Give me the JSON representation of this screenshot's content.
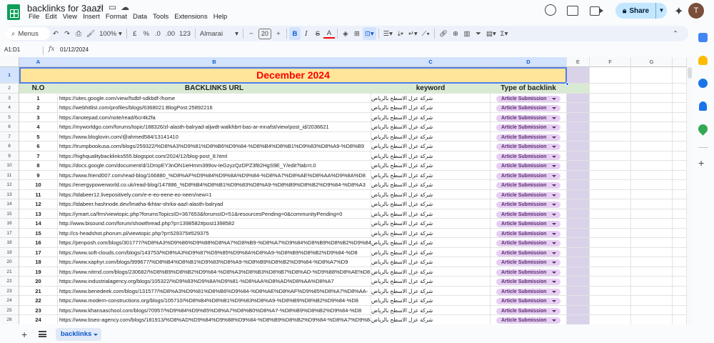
{
  "doc": {
    "title": "backlinks for 3aazl",
    "menu": [
      "File",
      "Edit",
      "View",
      "Insert",
      "Format",
      "Data",
      "Tools",
      "Extensions",
      "Help"
    ],
    "share_label": "Share",
    "avatar_letter": "T"
  },
  "toolbar": {
    "menus_label": "Menus",
    "zoom": "100%",
    "currency": "£",
    "percent": "%",
    "dec_decrease": ".0",
    "dec_increase": ".00",
    "number_format": "123",
    "font_name": "Almarai",
    "font_size": "20",
    "bold": "B",
    "italic": "I",
    "strike": "S",
    "text_color": "A"
  },
  "formula_bar": {
    "name_box": "A1:D1",
    "fx": "fx",
    "value": "01/12/2024"
  },
  "grid": {
    "columns": [
      "A",
      "B",
      "C",
      "D",
      "E",
      "F",
      "G"
    ],
    "title": "December 2024",
    "headers": [
      "N.O",
      "BACKLINKS URL",
      "keyword",
      "Type of backlink"
    ],
    "rows": [
      {
        "n": "1",
        "url": "https://sites.google.com/view/fsdbf-sdkbdf-/home",
        "kw": "شركة عزل الاسطح بالرياض",
        "type": "Article Submission"
      },
      {
        "n": "2",
        "url": "https://webhitlist.com/profiles/blogs/6368021:BlogPost:25892216",
        "kw": "شركة عزل الاسطح بالرياض",
        "type": "Article Submission"
      },
      {
        "n": "3",
        "url": "https://anotepad.com/note/read/6cr4k2fa",
        "kw": "شركة عزل الاسطح بالرياض",
        "type": "Article Submission"
      },
      {
        "n": "4",
        "url": "https://myworldgo.com/forums/topic/188326/zl-alasth-balryad-aljwdt-walkhbrt-bas-ar-mnafst/view/post_id/2036621",
        "kw": "شركة عزل الاسطح بالرياض",
        "type": "Article Submission"
      },
      {
        "n": "5",
        "url": "https://www.bloglovin.com/@ahmed584/13141410",
        "kw": "شركة عزل الاسطح بالرياض",
        "type": "Article Submission"
      },
      {
        "n": "6",
        "url": "https://trumpbookusa.com/blogs/259322/%D8%A3%D9%81%D8%B6%D9%84-%D8%B4%D8%B1%D9%83%D8%A9-%D8%B9",
        "kw": "شركة عزل الاسطح بالرياض",
        "type": "Article Submission"
      },
      {
        "n": "7",
        "url": "https://highqualitybacklinks555.blogspot.com/2024/12/blog-post_8.html",
        "kw": "شركة عزل الاسطح بالرياض",
        "type": "Article Submission"
      },
      {
        "n": "8",
        "url": "https://docs.google.com/document/d/1DmpEY3nON1ieHmm399ov-leGzyzQzDPZ3f82HgS9E_Y/edit?tab=t.0",
        "kw": "شركة عزل الاسطح بالرياض",
        "type": "Article Submission"
      },
      {
        "n": "9",
        "url": "https://www.friend007.com/read-blog/166880_%D8%AF%D9%84%D9%8A%D9%84-%D8%A7%D8%AE%D8%AA%D9%8A%D8",
        "kw": "شركة عزل الاسطح بالرياض",
        "type": "Article Submission"
      },
      {
        "n": "10",
        "url": "https://energypowerworld.co.uk/read-blog/147886_%D8%B4%D8%B1%D9%83%D8%A9-%D8%B9%D8%B2%D9%84-%D8%A3",
        "kw": "شركة عزل الاسطح بالرياض",
        "type": "Article Submission"
      },
      {
        "n": "11",
        "url": "https://tdabeer12.livepositively.com/e-e-eo-eene-eo-neen/new=1",
        "kw": "شركة عزل الاسطح بالرياض",
        "type": "Article Submission"
      },
      {
        "n": "12",
        "url": "https://tdabeer.hashnode.dev/lmatha-tkhtar-shrka-aazl-alasth-balryad",
        "kw": "شركة عزل الاسطح بالرياض",
        "type": "Article Submission"
      },
      {
        "n": "13",
        "url": "https://ymart.ca/frm/viewtopic.php?forumsTopicsID=367653&forumsID=51&resourcesPending=0&communityPending=0",
        "kw": "شركة عزل الاسطح بالرياض",
        "type": "Article Submission"
      },
      {
        "n": "14",
        "url": "http://www.bisound.com/forum/showthread.php?p=1398582#post1398582",
        "kw": "شركة عزل الاسطح بالرياض",
        "type": "Article Submission"
      },
      {
        "n": "15",
        "url": "http://cs-headshot.phorum.pl/viewtopic.php?p=529375#529375",
        "kw": "شركة عزل الاسطح بالرياض",
        "type": "Article Submission"
      },
      {
        "n": "16",
        "url": "https://penposh.com/blogs/301777/%D8%A3%D9%86%D9%88%D8%A7%D8%B9-%D8%A7%D9%84%D8%B9%D8%B2%D9%84-",
        "kw": "شركة عزل الاسطح بالرياض",
        "type": "Article Submission"
      },
      {
        "n": "17",
        "url": "https://www.soft-clouds.com/blogs/143753/%D8%A3%D9%87%D9%85%D9%8A%D8%A9-%D8%B9%D8%B2%D9%84-%D8",
        "kw": "شركة عزل الاسطح بالرياض",
        "type": "Article Submission"
      },
      {
        "n": "18",
        "url": "https://www.xaphyr.com/blogs/999677/%D8%B4%D8%B1%D9%83%D8%A9-%D8%B9%D8%B2%D9%84-%D8%A7%D9",
        "kw": "شركة عزل الاسطح بالرياض",
        "type": "Article Submission"
      },
      {
        "n": "19",
        "url": "https://www.nitrnd.com/blogs/230682/%D8%B9%D8%B2%D9%84-%D8%A3%D8%B3%D8%B7%D8%AD-%D9%88%D8%AE%D8",
        "kw": "شركة عزل الاسطح بالرياض",
        "type": "Article Submission"
      },
      {
        "n": "20",
        "url": "https://www.industrialagency.org/blogs/105322/%D9%83%D9%8A%D9%81-%D8%AA%D8%AD%D8%AA%D8%A7",
        "kw": "شركة عزل الاسطح بالرياض",
        "type": "Article Submission"
      },
      {
        "n": "21",
        "url": "https://www.benedeek.com/blogs/131577/%D8%A3%D9%81%D8%B6%D9%84-%D8%AE%D8%AF%D9%85%D8%A7%D8%AA-",
        "kw": "شركة عزل الاسطح بالرياض",
        "type": "Article Submission"
      },
      {
        "n": "22",
        "url": "https://www.modern-constructions.org/blogs/105710/%D8%B4%D8%B1%D9%83%D8%A9-%D8%B9%D8%B2%D9%84-%D8",
        "kw": "شركة عزل الاسطح بالرياض",
        "type": "Article Submission"
      },
      {
        "n": "23",
        "url": "https://www.khansaschool.com/blogs/70957/%D9%84%D9%85%D8%A7%D8%B0%D8%A7-%D8%B9%D8%B2%D9%84-%D8",
        "kw": "شركة عزل الاسطح بالرياض",
        "type": "Article Submission"
      },
      {
        "n": "24",
        "url": "https://www.bseo-agency.com/blogs/181913/%D8%AD%D9%84%D9%88%D9%84-%D8%B9%D8%B2%D9%84-%D8%A7%D9%84",
        "kw": "شركة عزل الاسطح بالرياض",
        "type": "Article Submission"
      }
    ]
  },
  "sheet_tab": {
    "label": "backlinks"
  },
  "colors": {
    "title_fill": "#ffe599",
    "title_text": "#ff0000",
    "header_fill": "#d9ead3",
    "chip_fill": "#e6cff2",
    "column_e_fill": "#d9d2e9"
  }
}
